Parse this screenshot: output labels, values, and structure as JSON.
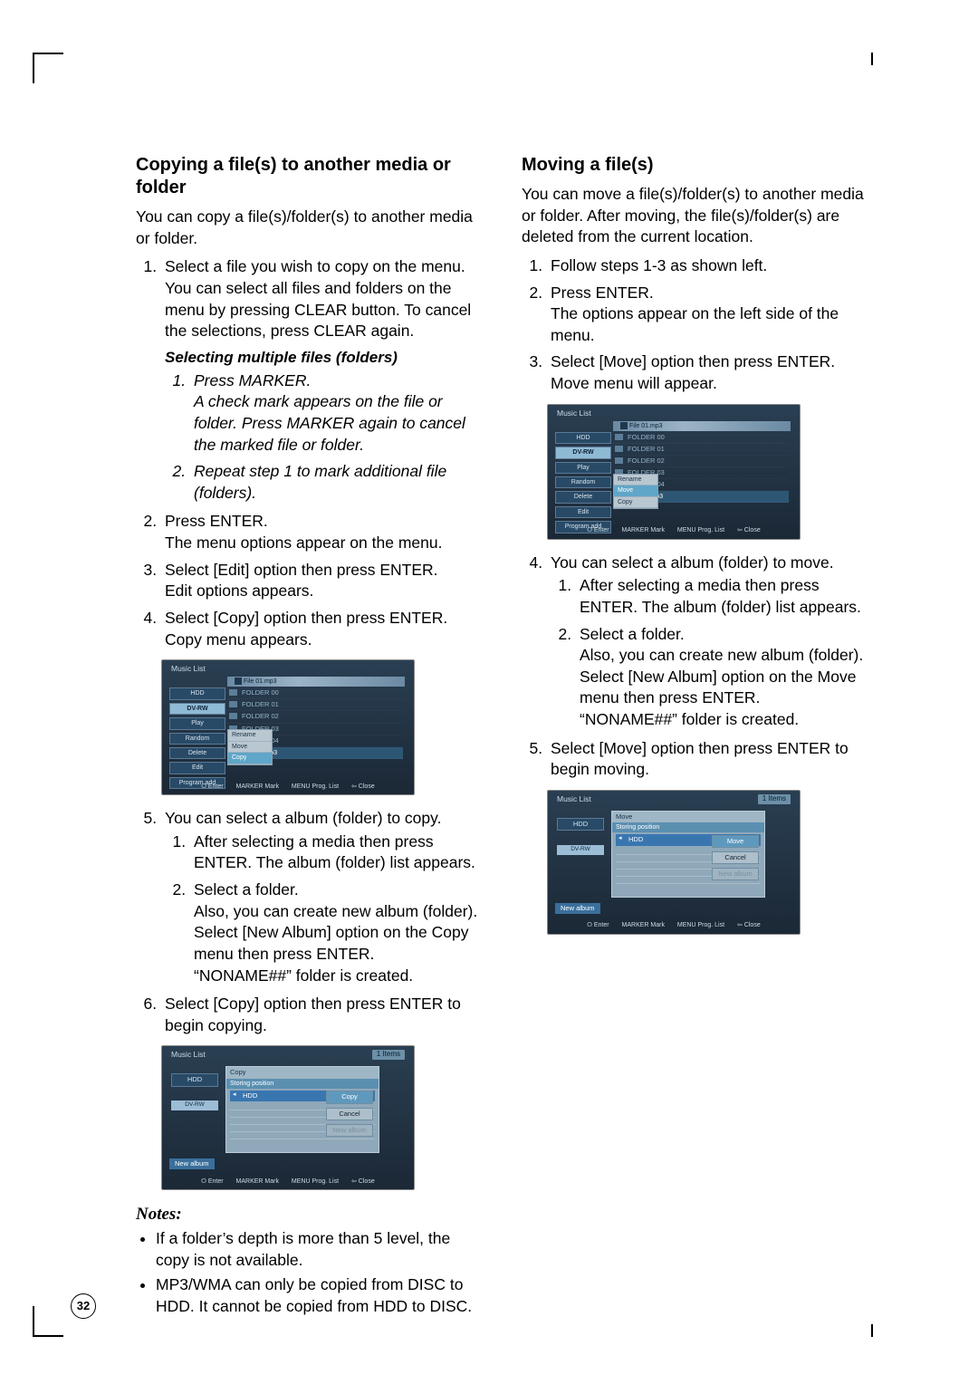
{
  "page_number": "32",
  "left": {
    "heading": "Copying a file(s) to another media or folder",
    "intro": "You can copy a file(s)/folder(s) to another media or folder.",
    "step1": "Select a file you wish to copy on the menu.\nYou can select all files and folders on the menu by pressing CLEAR button. To cancel the selections, press CLEAR again.",
    "sub_heading": "Selecting multiple files (folders)",
    "sub1": "Press MARKER.\nA check mark appears on the file or folder. Press MARKER again to cancel the marked file or folder.",
    "sub2": "Repeat step 1 to mark additional file (folders).",
    "step2": "Press ENTER.\nThe menu options appear on the menu.",
    "step3": "Select [Edit] option then press ENTER.\nEdit options appears.",
    "step4": "Select [Copy] option then press ENTER.\nCopy menu appears.",
    "step5": "You can select a album (folder) to copy.",
    "step5_1": "After selecting a media then press ENTER. The album (folder) list appears.",
    "step5_2": "Select a folder.\nAlso, you can create new album (folder). Select [New Album] option on the Copy menu then press ENTER.\n“NONAME##” folder is created.",
    "step6": "Select [Copy] option then press ENTER to begin copying.",
    "notes_head": "Notes:",
    "note1": "If a folder’s depth is more than 5 level, the copy is not available.",
    "note2": "MP3/WMA can only be copied from DISC to HDD. It cannot be copied from HDD to DISC."
  },
  "right": {
    "heading": "Moving a file(s)",
    "intro": "You can move a file(s)/folder(s) to another media or folder. After moving, the file(s)/folder(s) are deleted from the current location.",
    "step1": "Follow steps 1-3 as shown left.",
    "step2": "Press ENTER.\nThe options appear on the left side of the menu.",
    "step3": "Select [Move] option then press ENTER.\nMove menu will appear.",
    "step4": "You can select a album (folder) to move.",
    "step4_1": "After selecting a media then press ENTER. The album (folder) list appears.",
    "step4_2": "Select a folder.\nAlso, you can create new album (folder). Select [New Album] option on the Move menu then press ENTER.\n“NONAME##” folder is created.",
    "step5": "Select [Move] option then press ENTER to begin moving."
  },
  "ui": {
    "music_list": "Music List",
    "hdr_file": "File 01.mp3",
    "hdd": "HDD",
    "dvd": "DV-RW",
    "side_play": "Play",
    "side_random": "Random",
    "side_delete": "Delete",
    "side_edit": "Edit",
    "side_prog": "Program add",
    "folder00": "FOLDER 00",
    "folder01": "FOLDER 01",
    "folder02": "FOLDER 02",
    "folder03": "FOLDER 03",
    "folder04": "FOLDER 04",
    "popup_rename": "Rename",
    "popup_move": "Move",
    "popup_copy": "Copy",
    "popup_file": "File 02.mp3",
    "footer_enter": "⭘ Enter",
    "footer_mark": "MARKER Mark",
    "footer_menu": "MENU Prog. List",
    "footer_close": "⇦ Close",
    "items1": "1 Items",
    "copy_title": "Copy",
    "move_title": "Move",
    "storing": "Storing position",
    "btn_copy": "Copy",
    "btn_move": "Move",
    "btn_cancel": "Cancel",
    "btn_newalbum_dim": "New album",
    "new_album": "New album"
  }
}
